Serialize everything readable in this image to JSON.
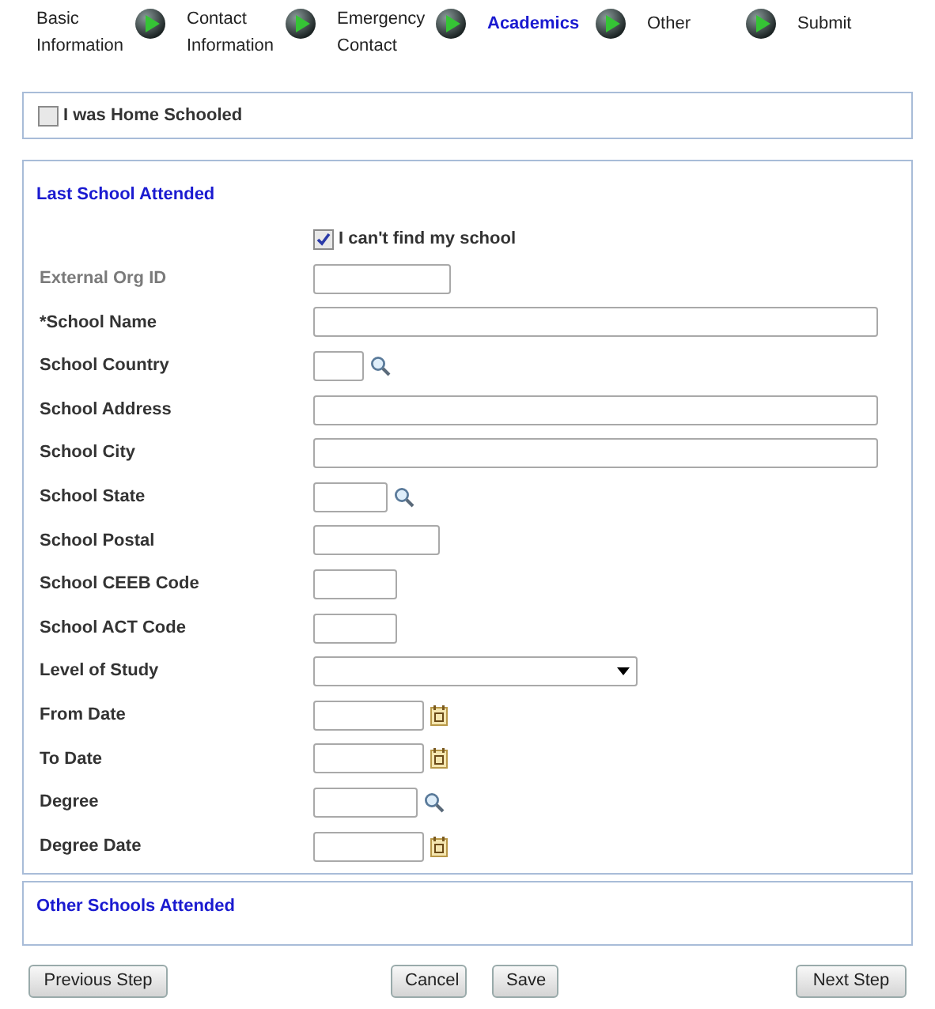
{
  "steps": [
    {
      "label": "Basic Information",
      "selected": false
    },
    {
      "label": "Contact Information",
      "selected": false
    },
    {
      "label": "Emergency Contact",
      "selected": false
    },
    {
      "label": "Academics",
      "selected": true
    },
    {
      "label": "Other",
      "selected": false
    },
    {
      "label": "Submit",
      "selected": false
    }
  ],
  "home_schooled": {
    "label": "I was Home Schooled",
    "checked": false
  },
  "last_school": {
    "title": "Last School Attended",
    "cant_find": {
      "label": "I can't find my school",
      "checked": true
    },
    "fields": [
      {
        "label": "External Org ID",
        "kind": "id",
        "disabled": true
      },
      {
        "label": "*School Name",
        "kind": "wide",
        "disabled": false
      },
      {
        "label": "School Country",
        "kind": "lookup",
        "disabled": false
      },
      {
        "label": "School Address",
        "kind": "wide",
        "disabled": false
      },
      {
        "label": "School City",
        "kind": "wide",
        "disabled": false
      },
      {
        "label": "School State",
        "kind": "lookup",
        "disabled": false
      },
      {
        "label": "School Postal",
        "kind": "postal",
        "disabled": false
      },
      {
        "label": "School CEEB Code",
        "kind": "code",
        "disabled": false
      },
      {
        "label": "School ACT Code",
        "kind": "code",
        "disabled": false
      },
      {
        "label": "Level of Study",
        "kind": "select",
        "disabled": false
      },
      {
        "label": "From Date",
        "kind": "date",
        "disabled": false
      },
      {
        "label": "To Date",
        "kind": "date",
        "disabled": false
      },
      {
        "label": "Degree",
        "kind": "lookup",
        "disabled": false
      },
      {
        "label": "Degree Date",
        "kind": "date",
        "disabled": false
      }
    ]
  },
  "other_schools": {
    "title": "Other Schools Attended"
  },
  "buttons": {
    "previous": "Previous Step",
    "cancel": "Cancel",
    "save": "Save",
    "next": "Next Step"
  }
}
